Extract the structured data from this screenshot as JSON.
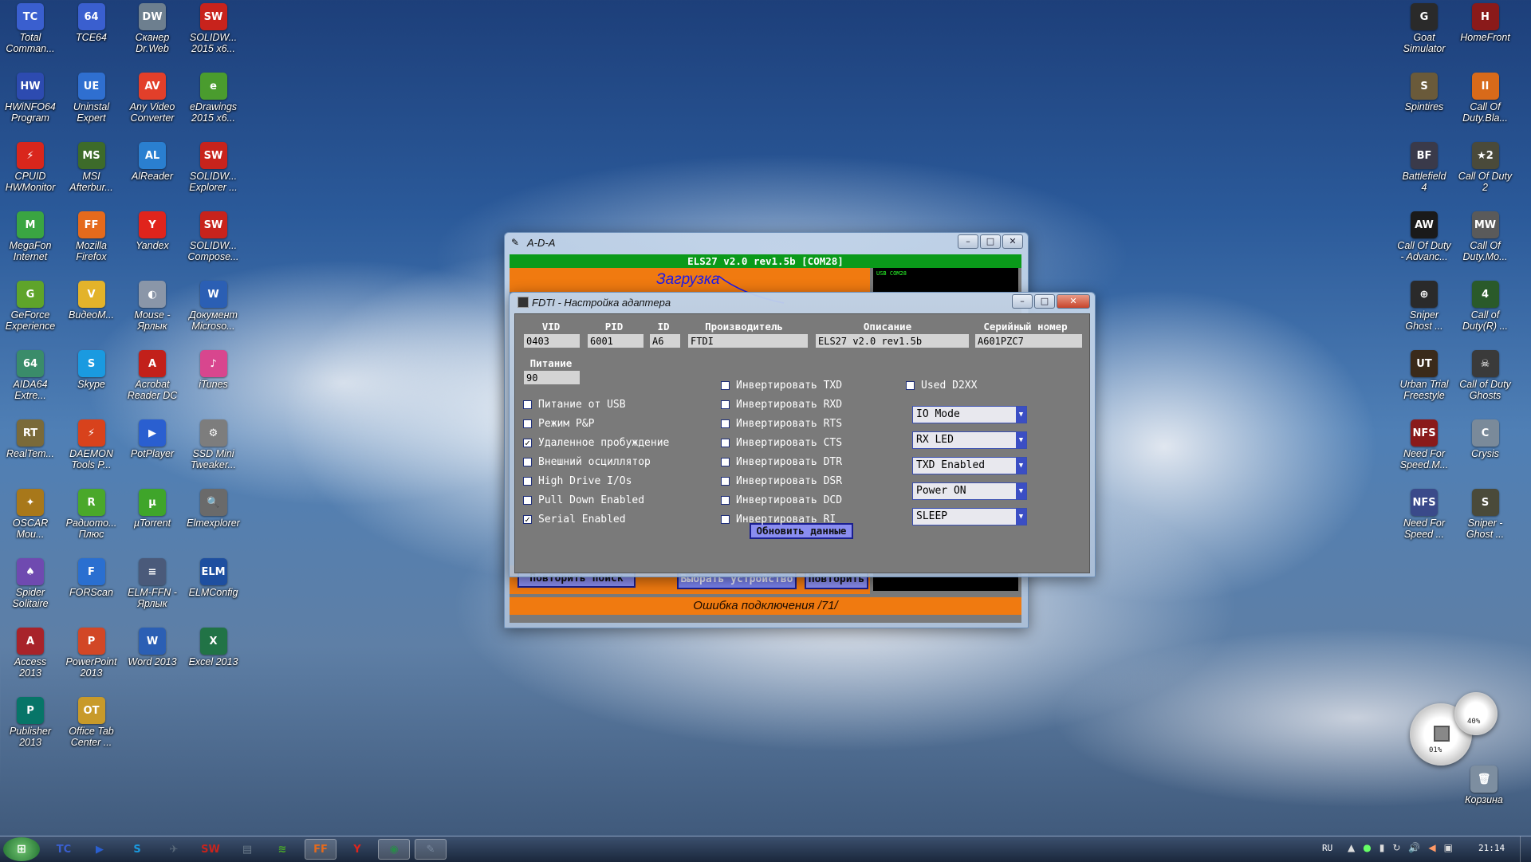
{
  "desktop_left": [
    {
      "label": "Total\nComman...",
      "icon": "floppy-icon",
      "color": "#3a5fcf",
      "txt": "TC"
    },
    {
      "label": "TCE64",
      "icon": "floppy-icon",
      "color": "#3a5fcf",
      "txt": "64"
    },
    {
      "label": "Сканер\nDr.Web",
      "icon": "spider-icon",
      "color": "#6d7f8f",
      "txt": "DW"
    },
    {
      "label": "SOLIDW...\n2015 x6...",
      "icon": "solidworks-icon",
      "color": "#c8231c",
      "txt": "SW"
    },
    {
      "label": "HWiNFO64\nProgram",
      "icon": "hwinfo-icon",
      "color": "#2d4bb0",
      "txt": "HW"
    },
    {
      "label": "Uninstal\nExpert",
      "icon": "uninstall-icon",
      "color": "#2f6fd0",
      "txt": "UE"
    },
    {
      "label": "Any Video\nConverter",
      "icon": "video-converter-icon",
      "color": "#e23f2a",
      "txt": "AV"
    },
    {
      "label": "eDrawings\n2015 x6...",
      "icon": "edrawings-icon",
      "color": "#4a9c2e",
      "txt": "e"
    },
    {
      "label": "CPUID\nHWMonitor",
      "icon": "cpuid-icon",
      "color": "#d9261c",
      "txt": "⚡"
    },
    {
      "label": "MSI\nAfterbur...",
      "icon": "msi-icon",
      "color": "#3d6b2a",
      "txt": "MS"
    },
    {
      "label": "AlReader",
      "icon": "alreader-icon",
      "color": "#2a7fd0",
      "txt": "AL"
    },
    {
      "label": "SOLIDW...\nExplorer ...",
      "icon": "solidworks-explorer-icon",
      "color": "#c8231c",
      "txt": "SW"
    },
    {
      "label": "MegaFon\nInternet",
      "icon": "megafon-icon",
      "color": "#3aa542",
      "txt": "M"
    },
    {
      "label": "Mozilla\nFirefox",
      "icon": "firefox-icon",
      "color": "#e56a1c",
      "txt": "FF"
    },
    {
      "label": "Yandex",
      "icon": "yandex-icon",
      "color": "#e0241c",
      "txt": "Y"
    },
    {
      "label": "SOLIDW...\nCompose...",
      "icon": "solidworks-composer-icon",
      "color": "#c8231c",
      "txt": "SW"
    },
    {
      "label": "GeForce\nExperience",
      "icon": "geforce-icon",
      "color": "#5fa42a",
      "txt": "G"
    },
    {
      "label": "ВидеоМ...",
      "icon": "video-master-icon",
      "color": "#e3b32a",
      "txt": "V"
    },
    {
      "label": "Mouse -\nЯрлык",
      "icon": "mouse-icon",
      "color": "#8a96a8",
      "txt": "◐"
    },
    {
      "label": "Документ\nMicroso...",
      "icon": "word-document-icon",
      "color": "#2b5fb4",
      "txt": "W"
    },
    {
      "label": "AIDA64\nExtre...",
      "icon": "aida64-icon",
      "color": "#3a8c6a",
      "txt": "64"
    },
    {
      "label": "Skype",
      "icon": "skype-icon",
      "color": "#1a9ae0",
      "txt": "S"
    },
    {
      "label": "Acrobat\nReader DC",
      "icon": "acrobat-icon",
      "color": "#c2201a",
      "txt": "A"
    },
    {
      "label": "iTunes",
      "icon": "itunes-icon",
      "color": "#d8468e",
      "txt": "♪"
    },
    {
      "label": "RealTem...",
      "icon": "realtemp-icon",
      "color": "#7a6a3a",
      "txt": "RT"
    },
    {
      "label": "DAEMON\nTools P...",
      "icon": "daemon-tools-icon",
      "color": "#d8421c",
      "txt": "⚡"
    },
    {
      "label": "PotPlayer",
      "icon": "potplayer-icon",
      "color": "#2a5fd0",
      "txt": "▶"
    },
    {
      "label": "SSD Mini\nTweaker...",
      "icon": "ssd-tweaker-icon",
      "color": "#7d7d7d",
      "txt": "⚙"
    },
    {
      "label": "OSCAR\nMou...",
      "icon": "oscar-mouse-icon",
      "color": "#a8781a",
      "txt": "✦"
    },
    {
      "label": "Радиото...\nПлюс",
      "icon": "radio-icon",
      "color": "#4aa82a",
      "txt": "R"
    },
    {
      "label": "µTorrent",
      "icon": "utorrent-icon",
      "color": "#3fa52a",
      "txt": "µ"
    },
    {
      "label": "Elmexplorer",
      "icon": "elmexplorer-icon",
      "color": "#6a6a6a",
      "txt": "🔍"
    },
    {
      "label": "Spider\nSolitaire",
      "icon": "spider-solitaire-icon",
      "color": "#6f4ab0",
      "txt": "♠"
    },
    {
      "label": "FORScan",
      "icon": "forscan-icon",
      "color": "#2a6fd0",
      "txt": "F"
    },
    {
      "label": "ELM-FFN -\nЯрлык",
      "icon": "elm-ffn-icon",
      "color": "#4a5a7a",
      "txt": "≡"
    },
    {
      "label": "ELMConfig",
      "icon": "elmconfig-icon",
      "color": "#1e4fa0",
      "txt": "ELM"
    },
    {
      "label": "Access\n2013",
      "icon": "access-icon",
      "color": "#a8232a",
      "txt": "A"
    },
    {
      "label": "PowerPoint\n2013",
      "icon": "powerpoint-icon",
      "color": "#d24726",
      "txt": "P"
    },
    {
      "label": "Word 2013",
      "icon": "word-icon",
      "color": "#2b5fb4",
      "txt": "W"
    },
    {
      "label": "Excel 2013",
      "icon": "excel-icon",
      "color": "#217346",
      "txt": "X"
    },
    {
      "label": "Publisher\n2013",
      "icon": "publisher-icon",
      "color": "#077568",
      "txt": "P"
    },
    {
      "label": "Office Tab\nCenter ...",
      "icon": "office-tab-icon",
      "color": "#c89a2a",
      "txt": "OT"
    }
  ],
  "desktop_right": [
    {
      "label": "Goat\nSimulator",
      "icon": "goat-icon",
      "color": "#2a2a2a",
      "txt": "G"
    },
    {
      "label": "HomeFront",
      "icon": "homefront-icon",
      "color": "#8a1a1a",
      "txt": "H"
    },
    {
      "label": "Spintires",
      "icon": "spintires-icon",
      "color": "#6a5a3a",
      "txt": "S"
    },
    {
      "label": "Call Of\nDuty.Bla...",
      "icon": "cod-black-ops-icon",
      "color": "#d86a1a",
      "txt": "II"
    },
    {
      "label": "Battlefield\n4",
      "icon": "battlefield-icon",
      "color": "#3a3a4a",
      "txt": "BF"
    },
    {
      "label": "Call Of Duty\n2",
      "icon": "cod2-icon",
      "color": "#4a4a3a",
      "txt": "★2"
    },
    {
      "label": "Call Of Duty\n- Advanc...",
      "icon": "cod-advanced-icon",
      "color": "#1a1a1a",
      "txt": "AW"
    },
    {
      "label": "Call Of\nDuty.Mo...",
      "icon": "cod-modern-icon",
      "color": "#5a5a5a",
      "txt": "MW"
    },
    {
      "label": "Sniper\nGhost ...",
      "icon": "sniper-ghost-icon",
      "color": "#2a2a2a",
      "txt": "⊕"
    },
    {
      "label": "Call of\nDuty(R) ...",
      "icon": "cod-r-icon",
      "color": "#2a5a2a",
      "txt": "4"
    },
    {
      "label": "Urban Trial\nFreestyle",
      "icon": "urban-trial-icon",
      "color": "#3a2a1a",
      "txt": "UT"
    },
    {
      "label": "Call of Duty\nGhosts",
      "icon": "cod-ghosts-icon",
      "color": "#3a3a3a",
      "txt": "☠"
    },
    {
      "label": "Need For\nSpeed.M...",
      "icon": "nfs-most-wanted-icon",
      "color": "#8a1a1a",
      "txt": "NFS"
    },
    {
      "label": "Crysis",
      "icon": "crysis-icon",
      "color": "#7a8a9a",
      "txt": "C"
    },
    {
      "label": "Need For\nSpeed ...",
      "icon": "nfs-icon",
      "color": "#3a4a8a",
      "txt": "NFS"
    },
    {
      "label": "Sniper -\nGhost ...",
      "icon": "sniper-ghost-2-icon",
      "color": "#4a4a3a",
      "txt": "S"
    }
  ],
  "recycle_bin": {
    "label": "Корзина"
  },
  "gadget": {
    "cpu": "01%",
    "ram": "40%"
  },
  "ada_window": {
    "title": "A-D-A",
    "banner": "ELS27 v2.0 rev1.5b [COM28]",
    "loading_text": "Загрузка",
    "terminal_text": "USB COM28",
    "retry_search": "Повторить поиск",
    "select_device": "Выбрать устройство",
    "retry": "Повторить",
    "status": "Ошибка подключения /71/"
  },
  "ftdi_dialog": {
    "title": "FDTI - Настройка адаптера",
    "headers": {
      "vid": "VID",
      "pid": "PID",
      "id": "ID",
      "manufacturer": "Производитель",
      "description": "Описание",
      "serial": "Серийный номер"
    },
    "values": {
      "vid": "0403",
      "pid": "6001",
      "id": "A6",
      "manufacturer": "FTDI",
      "description": "ELS27 v2.0 rev1.5b",
      "serial": "A601PZC7"
    },
    "power_label": "Питание",
    "power_value": "90",
    "left_options": [
      {
        "label": "Питание от USB",
        "checked": false
      },
      {
        "label": "Режим P&P",
        "checked": false
      },
      {
        "label": "Удаленное пробуждение",
        "checked": true
      },
      {
        "label": "Внешний осциллятор",
        "checked": false
      },
      {
        "label": "High Drive I/Os",
        "checked": false
      },
      {
        "label": "Pull Down Enabled",
        "checked": false
      },
      {
        "label": "Serial Enabled",
        "checked": true
      }
    ],
    "invert_options": [
      {
        "label": "Инвертировать TXD",
        "checked": false
      },
      {
        "label": "Инвертировать RXD",
        "checked": false
      },
      {
        "label": "Инвертировать RTS",
        "checked": false
      },
      {
        "label": "Инвертировать CTS",
        "checked": false
      },
      {
        "label": "Инвертировать DTR",
        "checked": false
      },
      {
        "label": "Инвертировать DSR",
        "checked": false
      },
      {
        "label": "Инвертировать DCD",
        "checked": false
      },
      {
        "label": "Инвертировать RI",
        "checked": false
      }
    ],
    "used_d2xx": {
      "label": "Used D2XX",
      "checked": false
    },
    "selects": [
      "IO Mode",
      "RX LED",
      "TXD Enabled",
      "Power ON",
      "SLEEP"
    ],
    "update_button": "Обновить данные"
  },
  "taskbar": {
    "language": "RU",
    "clock": "21:14",
    "items": [
      {
        "icon": "start-orb-icon",
        "color": "#2a8a2a",
        "txt": "⊞"
      },
      {
        "icon": "total-commander-icon",
        "color": "#3a5fcf",
        "txt": "TC"
      },
      {
        "icon": "potplayer-icon",
        "color": "#2a5fd0",
        "txt": "▶"
      },
      {
        "icon": "skype-icon",
        "color": "#1a9ae0",
        "txt": "S"
      },
      {
        "icon": "airplane-icon",
        "color": "#5a6a7a",
        "txt": "✈"
      },
      {
        "icon": "solidworks-icon",
        "color": "#c8231c",
        "txt": "SW"
      },
      {
        "icon": "notepad-icon",
        "color": "#6a7a8a",
        "txt": "▤"
      },
      {
        "icon": "wifi-icon",
        "color": "#4aa82a",
        "txt": "≋"
      },
      {
        "icon": "firefox-icon",
        "color": "#e56a1c",
        "txt": "FF"
      },
      {
        "icon": "yandex-icon",
        "color": "#e0241c",
        "txt": "Y"
      },
      {
        "icon": "ada-icon",
        "color": "#2a8a4a",
        "txt": "◉"
      },
      {
        "icon": "ftdi-icon",
        "color": "#7a8aa0",
        "txt": "✎"
      }
    ]
  }
}
